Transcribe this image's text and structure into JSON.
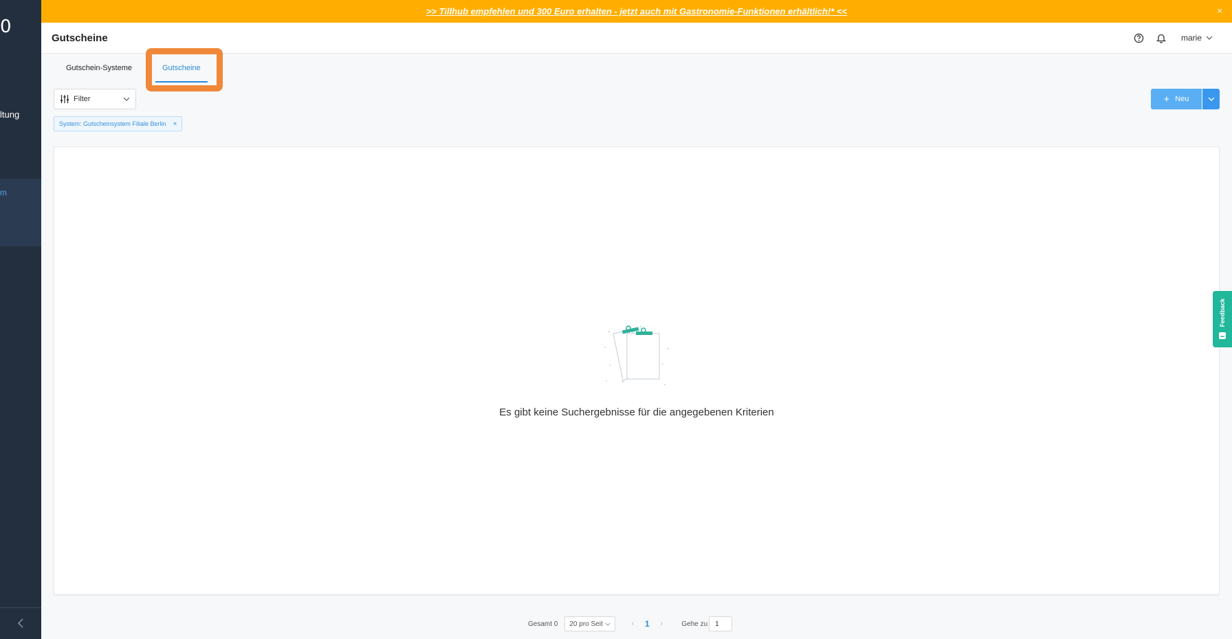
{
  "sidebar": {
    "logo_fragment": "0",
    "item_fragment": "ltung",
    "active_item_fragment": "m"
  },
  "banner": {
    "text": ">> Tillhub empfehlen und 300 Euro erhalten - jetzt auch mit Gastronomie-Funktionen erhältlich!* <<",
    "close_label": "×"
  },
  "header": {
    "title": "Gutscheine",
    "user_name": "marie"
  },
  "tabs": [
    {
      "label": "Gutschein-Systeme"
    },
    {
      "label": "Gutscheine"
    }
  ],
  "filter": {
    "label": "Filter"
  },
  "chip": {
    "label": "System: Gutscheinsystem Filiale Berlin",
    "remove": "×"
  },
  "new_button": {
    "label": "Neu",
    "plus": "+"
  },
  "empty_state": {
    "message": "Es gibt keine Suchergebnisse für die angegebenen Kriterien"
  },
  "feedback": {
    "label": "Feedback"
  },
  "pagination": {
    "total_label": "Gesamt 0",
    "per_page_label": "20 pro Seit",
    "current_page": "1",
    "goto_label": "Gehe zu",
    "goto_value": "1"
  },
  "colors": {
    "banner": "#ffae00",
    "sidebar": "#232f3e",
    "primary": "#5aaef4",
    "accent_highlight": "#f0883a",
    "feedback": "#21b79a"
  }
}
